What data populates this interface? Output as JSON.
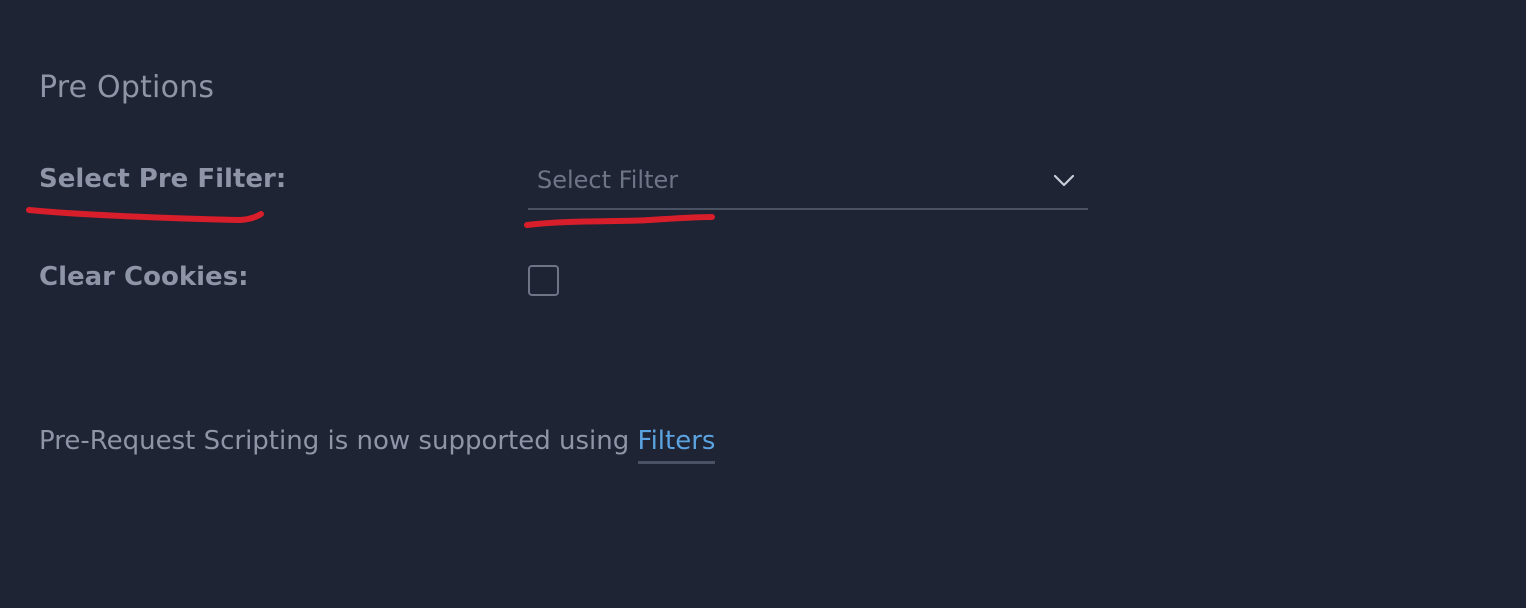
{
  "section": {
    "title": "Pre Options"
  },
  "pre_filter": {
    "label": "Select Pre Filter:",
    "placeholder": "Select Filter",
    "dropdown_icon": "chevron-down-icon"
  },
  "clear_cookies": {
    "label": "Clear Cookies:",
    "checked": false
  },
  "info": {
    "text": "Pre-Request Scripting is now supported using ",
    "link_label": "Filters"
  },
  "colors": {
    "background": "#1e2433",
    "text": "#8e95a6",
    "link": "#5ba3e0",
    "annotation": "#d81e2a"
  }
}
